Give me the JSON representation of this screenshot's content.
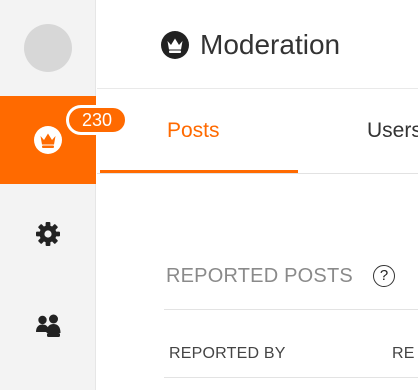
{
  "sidebar": {
    "badge_count": "230",
    "items": [
      {
        "name": "moderation",
        "icon": "crown-icon",
        "active": true
      },
      {
        "name": "settings",
        "icon": "gear-icon",
        "active": false
      },
      {
        "name": "users",
        "icon": "users-icon",
        "active": false
      }
    ]
  },
  "header": {
    "title": "Moderation",
    "icon": "crown-icon"
  },
  "tabs": [
    {
      "label": "Posts",
      "active": true
    },
    {
      "label": "Users",
      "active": false
    }
  ],
  "section": {
    "title": "REPORTED POSTS",
    "help_symbol": "?"
  },
  "table": {
    "columns": [
      "REPORTED BY",
      "RE"
    ]
  },
  "colors": {
    "accent": "#ff6a00",
    "sidebar_bg": "#f3f3f3",
    "text_dark": "#333333",
    "text_muted": "#8a8a8a"
  }
}
